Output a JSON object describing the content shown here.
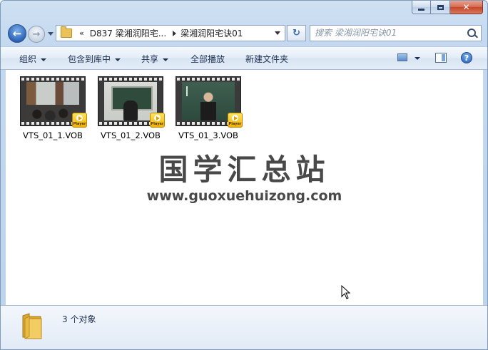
{
  "window": {
    "caption": {
      "minimize_icon": "minimize-icon",
      "maximize_icon": "maximize-icon",
      "close_icon": "close-icon",
      "close_glyph": "✕"
    }
  },
  "nav": {
    "back_glyph": "←",
    "forward_glyph": "→"
  },
  "address": {
    "overflow": "«",
    "crumbs": [
      "D837 梁湘润阳宅...",
      "梁湘润阳宅诀01"
    ],
    "refresh_glyph": "↻"
  },
  "search": {
    "placeholder": "搜索 梁湘润阳宅诀01"
  },
  "toolbar": {
    "organize": "组织",
    "include_in_library": "包含到库中",
    "share": "共享",
    "play_all": "全部播放",
    "new_folder": "新建文件夹",
    "help_glyph": "?"
  },
  "files": [
    {
      "name": "VTS_01_1.VOB",
      "badge": "Player"
    },
    {
      "name": "VTS_01_2.VOB",
      "badge": "Player"
    },
    {
      "name": "VTS_01_3.VOB",
      "badge": "Player"
    }
  ],
  "watermark": {
    "title": "国学汇总站",
    "url": "www.guoxuehuizong.com"
  },
  "details": {
    "count": "3 个对象"
  },
  "colors": {
    "accent": "#2d64b8",
    "close": "#c8452b",
    "badge": "#f2b300"
  }
}
